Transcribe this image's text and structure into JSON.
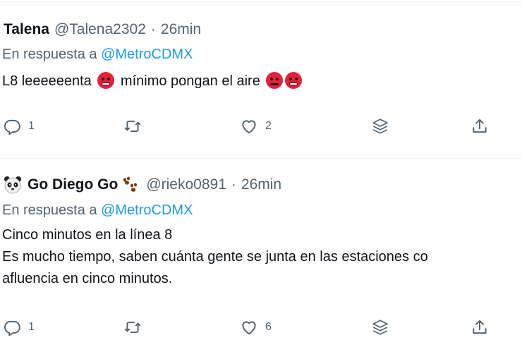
{
  "tweets": [
    {
      "display_name": "Talena",
      "handle": "@Talena2302",
      "separator": "·",
      "time": "26min",
      "reply_prefix": "En respuesta a",
      "reply_to": "@MetroCDMX",
      "text_parts": [
        "L8 leeeeeenta",
        "mínimo pongan el aire"
      ],
      "actions": {
        "replies": "1",
        "retweets": "",
        "likes": "2"
      }
    },
    {
      "display_name": "Go Diego Go",
      "handle": "@rieko0891",
      "separator": "·",
      "time": "26min",
      "reply_prefix": "En respuesta a",
      "reply_to": "@MetroCDMX",
      "text_lines": [
        "Cinco minutos en la línea 8",
        "Es mucho tiempo, saben cuánta gente se junta en las estaciones co",
        "afluencia en cinco minutos."
      ],
      "actions": {
        "replies": "1",
        "retweets": "",
        "likes": "6"
      }
    }
  ],
  "icons": {
    "reply": "reply-icon",
    "retweet": "retweet-icon",
    "like": "heart-icon",
    "stack": "stack-icon",
    "share": "share-icon",
    "emoji": "angry-face-emoji",
    "avatar": "panda-emoji",
    "badge": "paw-prints-emoji"
  },
  "colors": {
    "link": "#1d9bf0",
    "muted": "#536471",
    "text": "#0f1419",
    "divider": "#eff3f4"
  }
}
